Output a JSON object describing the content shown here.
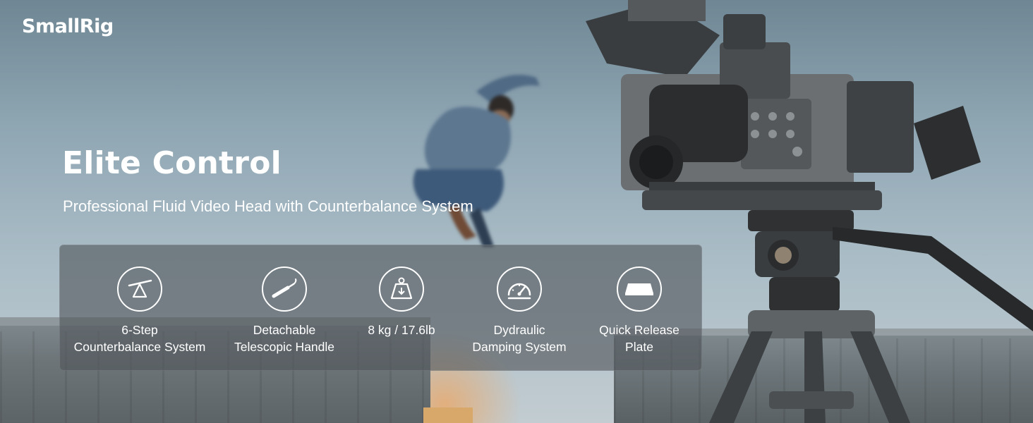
{
  "brand": {
    "logo_text": "SmallRig"
  },
  "hero": {
    "title": "Elite Control",
    "subtitle": "Professional Fluid Video Head with Counterbalance System"
  },
  "features": [
    {
      "icon": "seesaw-balance-icon",
      "line1": "6-Step",
      "line2": "Counterbalance System"
    },
    {
      "icon": "telescopic-handle-icon",
      "line1": "Detachable",
      "line2": "Telescopic Handle"
    },
    {
      "icon": "weight-icon",
      "line1": "8 kg / 17.6lb",
      "line2": ""
    },
    {
      "icon": "gauge-icon",
      "line1": "Dydraulic",
      "line2": "Damping System"
    },
    {
      "icon": "quick-release-plate-icon",
      "line1": "Quick Release",
      "line2": "Plate"
    }
  ],
  "colors": {
    "text": "#ffffff",
    "panel": "#50565a"
  }
}
